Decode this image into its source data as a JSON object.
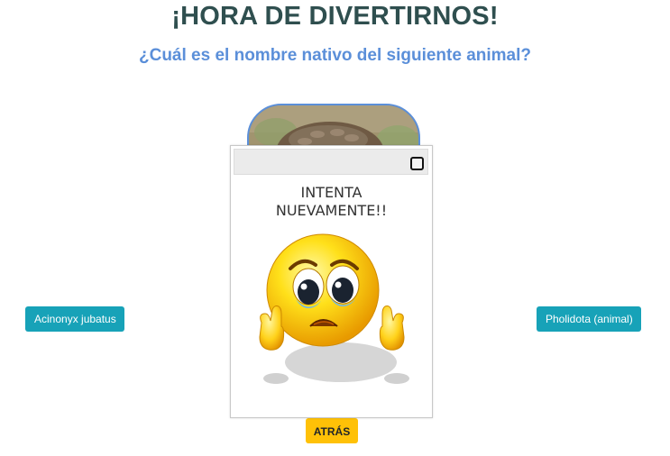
{
  "header": {
    "title": "¡HORA DE DIVERTIRNOS!",
    "subtitle": "¿Cuál es el nombre nativo del siguiente animal?"
  },
  "quiz": {
    "options": [
      "Acinonyx jubatus",
      "Pholidota (animal)"
    ],
    "back_label": "ATRÁS",
    "image_icon": "pangolin-photo"
  },
  "modal": {
    "message_line1": "INTENTA",
    "message_line2": "NUEVAMENTE!!",
    "emoji_icon": "sad-crying-emoji-icon",
    "close_icon": "close-square-icon"
  },
  "colors": {
    "title": "#2f4f4f",
    "subtitle": "#5b8fd9",
    "option_button": "#17a2b8",
    "back_button": "#ffc107"
  }
}
